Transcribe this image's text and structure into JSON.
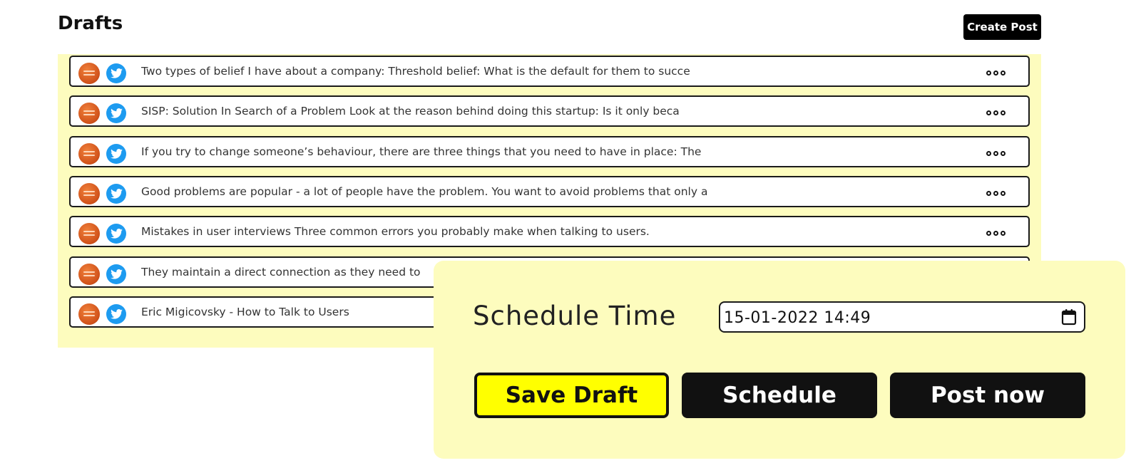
{
  "header": {
    "title": "Drafts",
    "create_label": "Create Post"
  },
  "drafts": [
    {
      "text": "Two types of belief I have about a company: Threshold belief: What is the default for them to succe"
    },
    {
      "text": "SISP: Solution In Search of a Problem Look at the reason behind doing this startup: Is it only beca"
    },
    {
      "text": "If you try to change someone’s behaviour, there are three things that you need to have in place: The"
    },
    {
      "text": "Good problems are popular - a lot of people have the problem. You want to avoid problems that only a"
    },
    {
      "text": "Mistakes in user interviews Three common errors you probably make when talking to users."
    },
    {
      "text": "They maintain a direct connection as they need to"
    },
    {
      "text": "Eric Migicovsky - How to Talk to Users"
    }
  ],
  "icons": {
    "avatar": "startup-school-avatar",
    "network": "twitter-icon",
    "more": "more-options-icon",
    "calendar": "calendar-icon"
  },
  "schedule": {
    "label": "Schedule Time",
    "datetime_value": "15-01-2022 14:49",
    "save_label": "Save Draft",
    "schedule_label": "Schedule",
    "post_label": "Post now"
  },
  "colors": {
    "panel_bg": "#fdfcbe",
    "save_button": "#ffff00",
    "dark_button": "#111111",
    "twitter_blue": "#1d9bf0",
    "avatar_orange": "#d2541c"
  }
}
